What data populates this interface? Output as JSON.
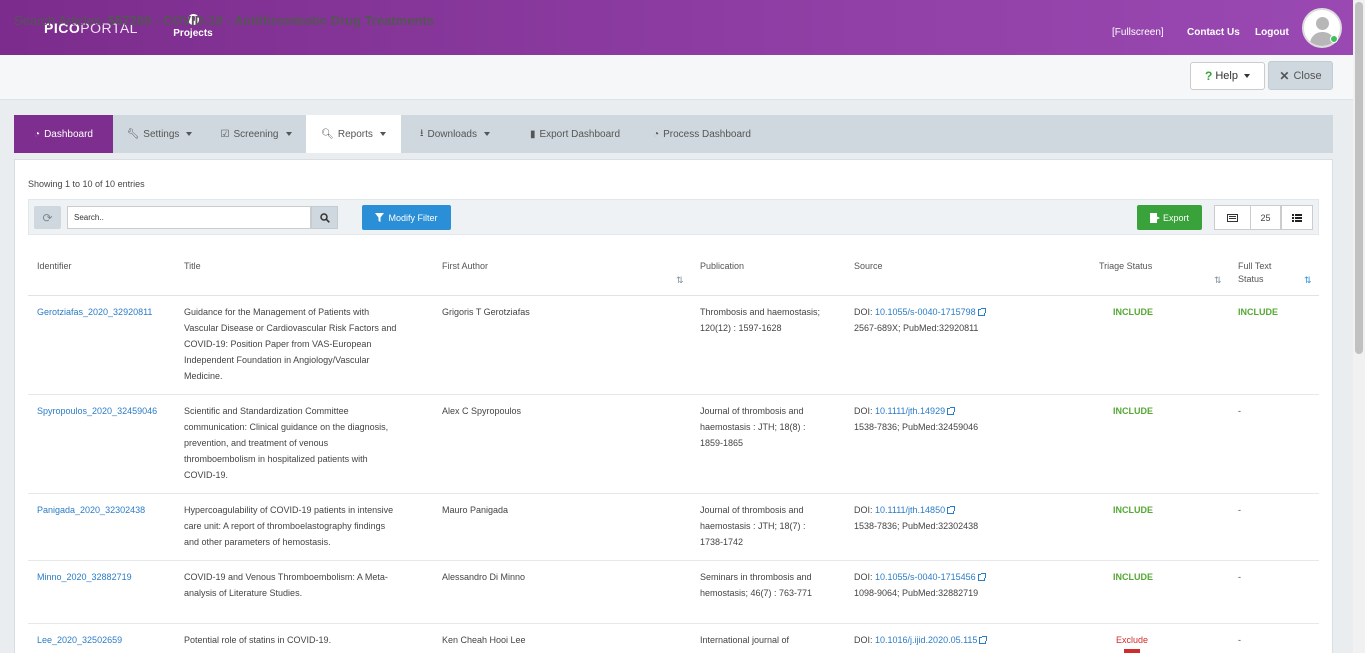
{
  "header": {
    "logo_pico": "PICO",
    "logo_portal": "PORTAL",
    "projects_label": "Projects",
    "fullscreen_label": "[Fullscreen]",
    "contact_label": "Contact Us",
    "logout_label": "Logout"
  },
  "title": {
    "prefix": "Search Articles: ",
    "project": "557260 - COVID-19 - Antithrombotic Drug Treatments",
    "help_label": "Help",
    "close_label": "Close"
  },
  "tabs": [
    {
      "label": "Dashboard"
    },
    {
      "label": "Settings"
    },
    {
      "label": "Screening"
    },
    {
      "label": "Reports"
    },
    {
      "label": "Downloads"
    },
    {
      "label": "Export Dashboard"
    },
    {
      "label": "Process Dashboard"
    }
  ],
  "table_tools": {
    "showing": "Showing 1 to 10 of 10 entries",
    "search_placeholder": "Search..",
    "modify_filter_label": "Modify Filter",
    "export_label": "Export",
    "page_size": "25"
  },
  "columns": {
    "identifier": "Identifier",
    "title": "Title",
    "first_author": "First Author",
    "publication": "Publication",
    "source": "Source",
    "triage_status": "Triage Status",
    "full_text_status_1": "Full Text",
    "full_text_status_2": "Status"
  },
  "rows": [
    {
      "identifier": "Gerotziafas_2020_32920811",
      "title": [
        "Guidance for the Management of Patients with",
        "Vascular Disease or Cardiovascular Risk Factors and",
        "COVID-19: Position Paper from VAS-European",
        "Independent Foundation in Angiology/Vascular",
        "Medicine."
      ],
      "author": "Grigoris T Gerotziafas",
      "publication": [
        "Thrombosis and haemostasis;",
        "120(12) : 1597-1628"
      ],
      "doi_prefix": "DOI: ",
      "doi": "10.1055/s-0040-1715798",
      "source_line2": "2567-689X; PubMed:32920811",
      "triage": "INCLUDE",
      "fulltext": "INCLUDE"
    },
    {
      "identifier": "Spyropoulos_2020_32459046",
      "title": [
        "Scientific and Standardization Committee",
        "communication: Clinical guidance on the diagnosis,",
        "prevention, and treatment of venous",
        "thromboembolism in hospitalized patients with",
        "COVID-19."
      ],
      "author": "Alex C Spyropoulos",
      "publication": [
        "Journal of thrombosis and",
        "haemostasis : JTH; 18(8) :",
        "1859-1865"
      ],
      "doi_prefix": "DOI: ",
      "doi": "10.1111/jth.14929",
      "source_line2": "1538-7836; PubMed:32459046",
      "triage": "INCLUDE",
      "fulltext": "-"
    },
    {
      "identifier": "Panigada_2020_32302438",
      "title": [
        "Hypercoagulability of COVID-19 patients in intensive",
        "care unit: A report of thromboelastography findings",
        "and other parameters of hemostasis."
      ],
      "author": "Mauro Panigada",
      "publication": [
        "Journal of thrombosis and",
        "haemostasis : JTH; 18(7) :",
        "1738-1742"
      ],
      "doi_prefix": "DOI: ",
      "doi": "10.1111/jth.14850",
      "source_line2": "1538-7836; PubMed:32302438",
      "triage": "INCLUDE",
      "fulltext": "-"
    },
    {
      "identifier": "Minno_2020_32882719",
      "title": [
        "COVID-19 and Venous Thromboembolism: A Meta-",
        "analysis of Literature Studies."
      ],
      "author": "Alessandro Di Minno",
      "publication": [
        "Seminars in thrombosis and",
        "hemostasis; 46(7) : 763-771"
      ],
      "doi_prefix": "DOI: ",
      "doi": "10.1055/s-0040-1715456",
      "source_line2": "1098-9064; PubMed:32882719",
      "triage": "INCLUDE",
      "fulltext": "-"
    },
    {
      "identifier": "Lee_2020_32502659",
      "title": [
        "Potential role of statins in COVID-19."
      ],
      "author": "Ken Cheah Hooi Lee",
      "publication": [
        "International journal of"
      ],
      "doi_prefix": "DOI: ",
      "doi": "10.1016/j.ijid.2020.05.115",
      "source_line2": "",
      "triage": "Exclude",
      "fulltext": "-"
    }
  ],
  "colors": {
    "header_purple": "#8e3ea3",
    "active_tab": "#7e2e8f",
    "include_green": "#55a834",
    "exclude_red": "#d12c2c",
    "link_blue": "#2a7cc7"
  }
}
